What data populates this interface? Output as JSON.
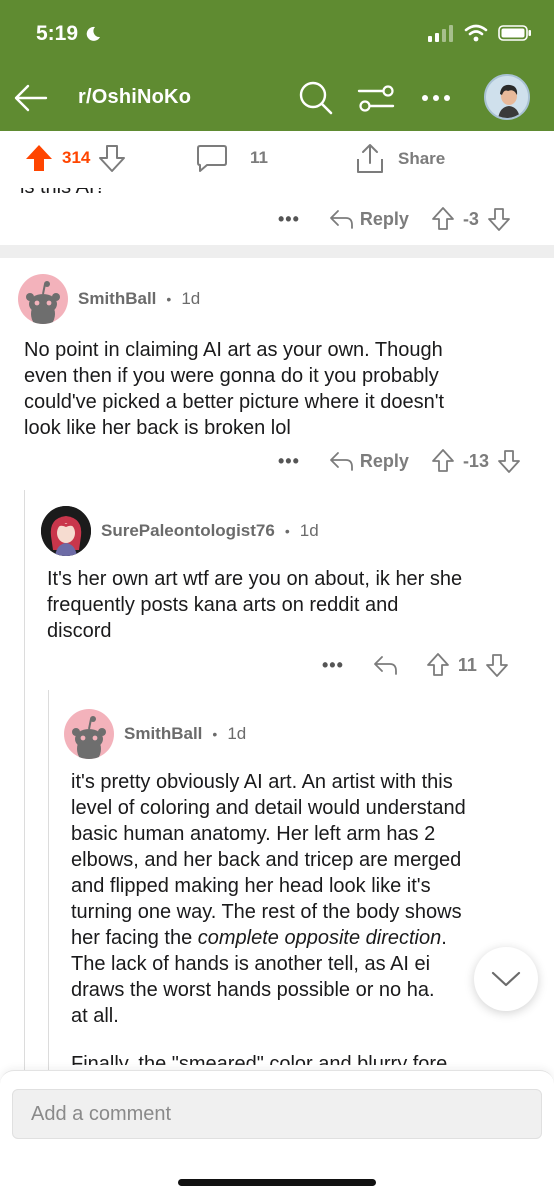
{
  "status_bar": {
    "time": "5:19"
  },
  "nav": {
    "subreddit": "r/OshiNoKo"
  },
  "post_actions": {
    "upvotes": "314",
    "comments": "11",
    "share_label": "Share"
  },
  "previous_comment": {
    "cut_text": "is this AI?",
    "actions": {
      "more": "•••",
      "reply": "Reply",
      "score": "-3"
    }
  },
  "comments": [
    {
      "author": "SmithBall",
      "age": "1d",
      "separator": "•",
      "lines": [
        "No point in claiming AI art as your own. Though",
        "even then if you were gonna do it you probably",
        "could've picked a better picture where it doesn't",
        "look like her back is broken lol"
      ],
      "actions": {
        "more": "•••",
        "reply": "Reply",
        "score": "-13"
      }
    },
    {
      "author": "SurePaleontologist76",
      "age": "1d",
      "separator": "•",
      "lines": [
        "It's her own art wtf are you on about, ik her she",
        "frequently posts kana arts on reddit and",
        "discord"
      ],
      "actions": {
        "more": "•••",
        "score": "11"
      }
    },
    {
      "author": "SmithBall",
      "age": "1d",
      "separator": "•",
      "lines_before_em": [
        "it's pretty obviously AI art. An artist with this",
        "level of coloring and detail would understand",
        "basic human anatomy. Her left arm has 2",
        "elbows, and her back and tricep are merged",
        "and flipped making her head look like it's",
        "turning one way. The rest of the body shows"
      ],
      "em_line_start": "her facing the ",
      "em_text": "complete opposite direction",
      "em_line_end": ".",
      "lines_after_em": [
        "The lack of hands is another tell, as AI ei",
        "draws the worst hands possible or no ha.",
        "at all."
      ],
      "cut_line": "Finally, the \"smeared\" color and blurry fore"
    }
  ],
  "composer": {
    "placeholder": "Add a comment"
  },
  "colors": {
    "header": "#5f8b31",
    "upvote": "#ff4500",
    "text": "#1a1a1b",
    "meta": "#7c7c7c"
  },
  "icons": [
    "back-arrow-icon",
    "search-icon",
    "filter-icon",
    "more-icon",
    "upvote-icon",
    "downvote-icon",
    "comment-icon",
    "share-icon",
    "reply-icon",
    "chevron-down-icon",
    "wifi-icon",
    "signal-icon",
    "battery-icon",
    "moon-icon"
  ]
}
